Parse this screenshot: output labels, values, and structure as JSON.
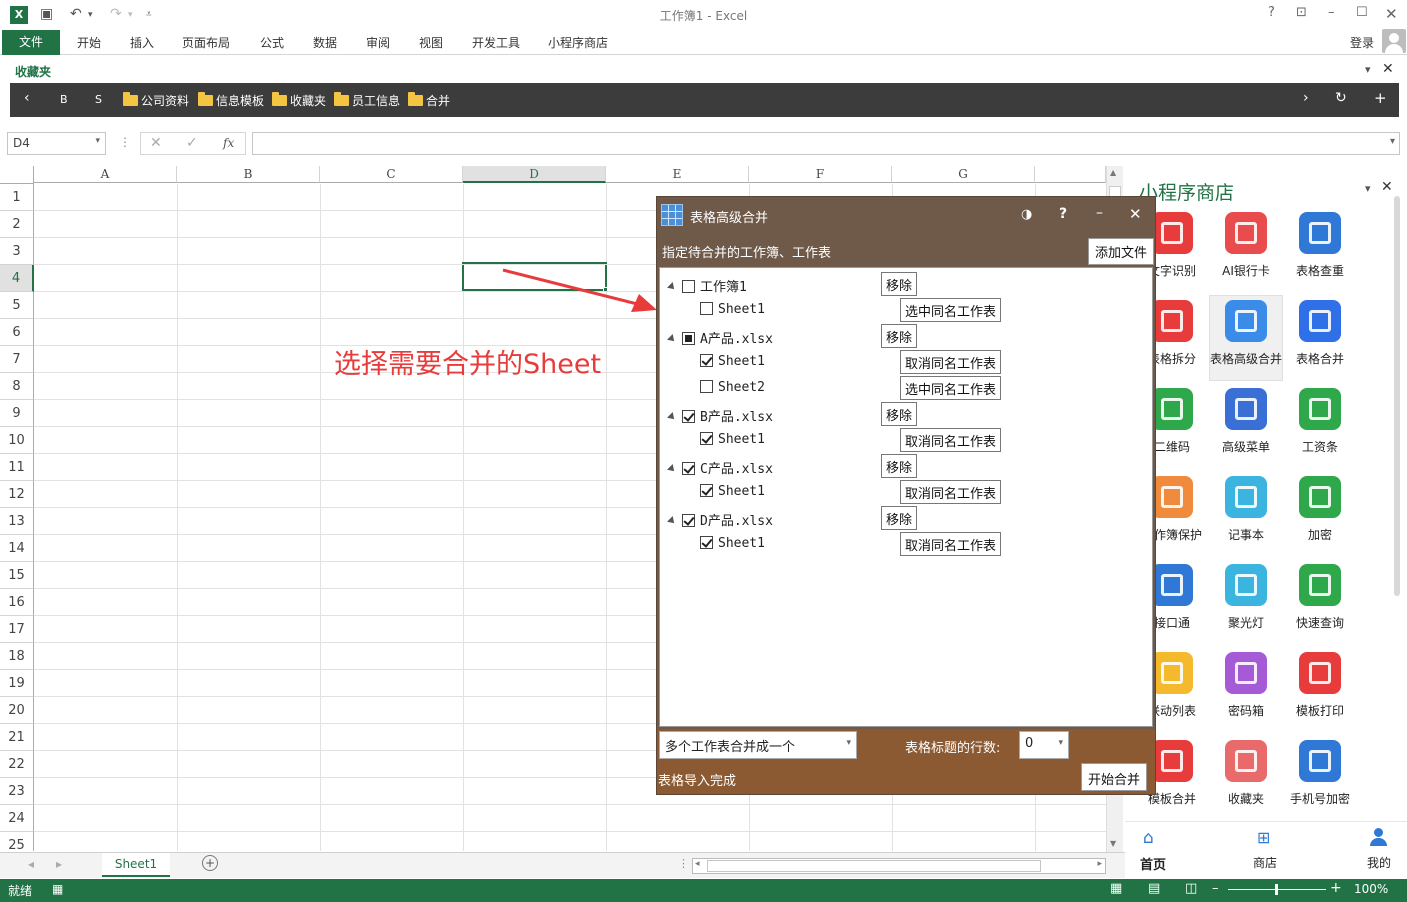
{
  "app": {
    "title": "工作簿1 - Excel",
    "login": "登录"
  },
  "ribbon": {
    "file": "文件",
    "tabs": [
      "开始",
      "插入",
      "页面布局",
      "公式",
      "数据",
      "审阅",
      "视图",
      "开发工具",
      "小程序商店"
    ]
  },
  "favorites": {
    "label": "收藏夹",
    "b_label": "B",
    "s_label": "S",
    "folders": [
      "公司资料",
      "信息模板",
      "收藏夹",
      "员工信息",
      "合并"
    ]
  },
  "formula_bar": {
    "name_box": "D4",
    "fx": "fx",
    "value": ""
  },
  "grid": {
    "columns": [
      "A",
      "B",
      "C",
      "D",
      "E",
      "F",
      "G"
    ],
    "rows": [
      "1",
      "2",
      "3",
      "4",
      "5",
      "6",
      "7",
      "8",
      "9",
      "10",
      "11",
      "12",
      "13",
      "14",
      "15",
      "16",
      "17",
      "18",
      "19",
      "20",
      "21",
      "22",
      "23",
      "24",
      "25"
    ],
    "selected_cell": "D4"
  },
  "annotation": "选择需要合并的Sheet",
  "sheet_tabs": [
    "Sheet1"
  ],
  "status": {
    "ready": "就绪",
    "zoom": "100%"
  },
  "panel": {
    "title": "小程序商店",
    "tiles": [
      {
        "label": "文字识别",
        "color": "#e83b3b",
        "icon": "text-recognition-icon"
      },
      {
        "label": "AI银行卡",
        "color": "#e84c4c",
        "icon": "bank-card-icon"
      },
      {
        "label": "表格查重",
        "color": "#2f78d6",
        "icon": "table-dedupe-icon"
      },
      {
        "label": "表格拆分",
        "color": "#e83b3b",
        "icon": "table-split-icon"
      },
      {
        "label": "表格高级合并",
        "color": "#3b8be8",
        "icon": "table-advanced-merge-icon"
      },
      {
        "label": "表格合并",
        "color": "#2f6fe8",
        "icon": "table-merge-icon"
      },
      {
        "label": "二维码",
        "color": "#2ea84a",
        "icon": "qrcode-icon"
      },
      {
        "label": "高级菜单",
        "color": "#3a6fd6",
        "icon": "advanced-menu-icon"
      },
      {
        "label": "工资条",
        "color": "#2ea84a",
        "icon": "payslip-icon"
      },
      {
        "label": "工作簿保护",
        "color": "#f08a3c",
        "icon": "workbook-protect-icon"
      },
      {
        "label": "记事本",
        "color": "#3bb5e0",
        "icon": "notepad-icon"
      },
      {
        "label": "加密",
        "color": "#2ea84a",
        "icon": "encrypt-icon"
      },
      {
        "label": "接口通",
        "color": "#2f78d6",
        "icon": "api-icon"
      },
      {
        "label": "聚光灯",
        "color": "#3bb5e0",
        "icon": "spotlight-icon"
      },
      {
        "label": "快速查询",
        "color": "#2ea84a",
        "icon": "quick-search-icon"
      },
      {
        "label": "联动列表",
        "color": "#f5b92e",
        "icon": "linked-list-icon"
      },
      {
        "label": "密码箱",
        "color": "#a55ad6",
        "icon": "password-box-icon"
      },
      {
        "label": "模板打印",
        "color": "#e83b3b",
        "icon": "template-print-icon"
      },
      {
        "label": "模板合并",
        "color": "#e83b3b",
        "icon": "template-merge-icon"
      },
      {
        "label": "收藏夹",
        "color": "#e86a6a",
        "icon": "favorites-icon"
      },
      {
        "label": "手机号加密",
        "color": "#2f78d6",
        "icon": "phone-encrypt-icon"
      }
    ],
    "nav": [
      "首页",
      "商店",
      "我的"
    ]
  },
  "dialog": {
    "title": "表格高级合并",
    "subtitle": "指定待合并的工作簿、工作表",
    "add_file": "添加文件",
    "tree": [
      {
        "name": "工作簿1",
        "state": "unchecked",
        "button": "移除",
        "sheets": [
          {
            "name": "Sheet1",
            "checked": false,
            "button": "选中同名工作表"
          }
        ]
      },
      {
        "name": "A产品.xlsx",
        "state": "partial",
        "button": "移除",
        "sheets": [
          {
            "name": "Sheet1",
            "checked": true,
            "button": "取消同名工作表"
          },
          {
            "name": "Sheet2",
            "checked": false,
            "button": "选中同名工作表"
          }
        ]
      },
      {
        "name": "B产品.xlsx",
        "state": "checked",
        "button": "移除",
        "sheets": [
          {
            "name": "Sheet1",
            "checked": true,
            "button": "取消同名工作表"
          }
        ]
      },
      {
        "name": "C产品.xlsx",
        "state": "checked",
        "button": "移除",
        "sheets": [
          {
            "name": "Sheet1",
            "checked": true,
            "button": "取消同名工作表"
          }
        ]
      },
      {
        "name": "D产品.xlsx",
        "state": "checked",
        "button": "移除",
        "sheets": [
          {
            "name": "Sheet1",
            "checked": true,
            "button": "取消同名工作表"
          }
        ]
      }
    ],
    "mode": "多个工作表合并成一个",
    "header_rows_label": "表格标题的行数:",
    "header_rows": "0",
    "status": "表格导入完成",
    "start": "开始合并"
  }
}
